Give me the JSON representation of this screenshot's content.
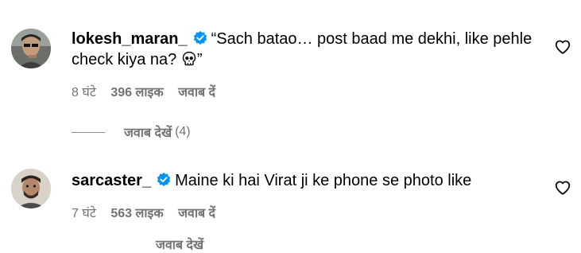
{
  "comments": [
    {
      "username": "lokesh_maran_",
      "text_line1": "“Sach batao… post baad me dekhi, like pehle",
      "text_line2": "check kiya na? ",
      "text_end": "”",
      "time": "8 घंटे",
      "likes": "396 लाइक",
      "reply": "जवाब दें"
    },
    {
      "username": "sarcaster_",
      "text_line1": "Maine ki hai Virat ji ke phone se photo like",
      "time": "7 घंटे",
      "likes": "563 लाइक",
      "reply": "जवाब दें"
    }
  ],
  "view_replies": {
    "label": "जवाब देखें",
    "count": "(4)"
  },
  "cut_off_text": "जवाब देखें",
  "colors": {
    "verified": "#0095f6",
    "meta": "#737373"
  },
  "icons": [
    "verified-badge-icon",
    "heart-icon",
    "skull-emoji-icon"
  ]
}
